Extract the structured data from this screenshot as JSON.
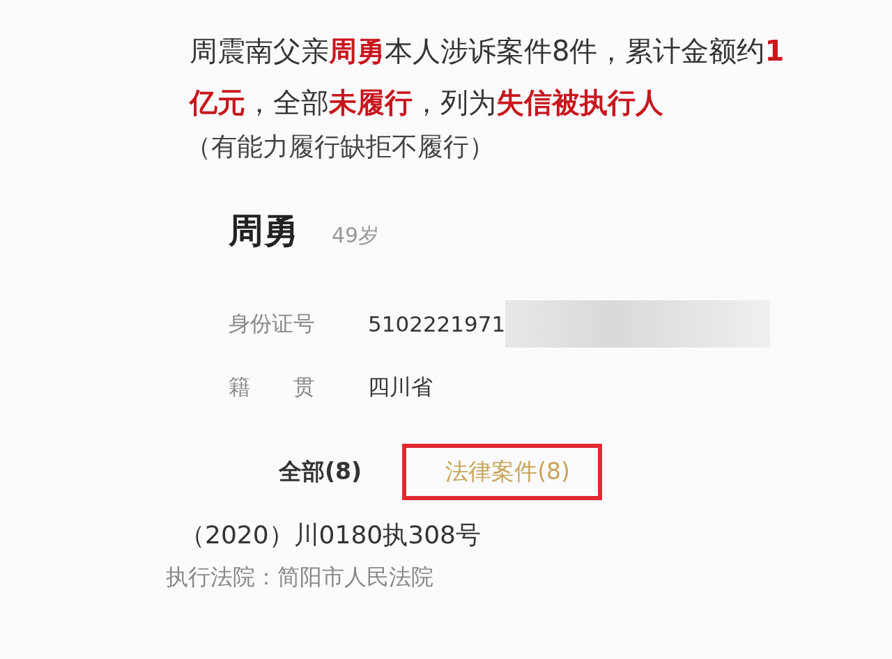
{
  "summary": [
    {
      "text": "周震南父亲",
      "highlighted": false
    },
    {
      "text": "周勇",
      "highlighted": true
    },
    {
      "text": "本人涉诉案件8件，累计金额约",
      "highlighted": false
    },
    {
      "text": "1亿元",
      "highlighted": true
    },
    {
      "text": "，全部",
      "highlighted": false
    },
    {
      "text": "未履行",
      "highlighted": true
    },
    {
      "text": "，列为",
      "highlighted": false
    },
    {
      "text": "失信被执行人",
      "highlighted": true
    }
  ],
  "note": "（有能力履行缺拒不履行）",
  "person": {
    "name": "周勇",
    "age": "49岁"
  },
  "fields": [
    {
      "label": "身份证号",
      "value": "5102221971",
      "redacted": true
    },
    {
      "label": "籍　　贯",
      "value": "四川省",
      "redacted": false
    }
  ],
  "tabs": [
    {
      "label": "全部(8)",
      "selected": false,
      "annotated": false
    },
    {
      "label": "法律案件(8)",
      "selected": true,
      "annotated": true
    }
  ],
  "case": {
    "number": "（2020）川0180执308号",
    "court": "执行法院：简阳市人民法院"
  }
}
